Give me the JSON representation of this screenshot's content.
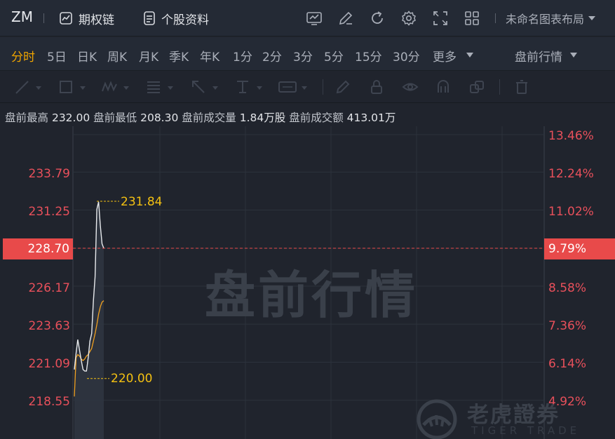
{
  "header": {
    "symbol": "ZM",
    "options_chain": "期权链",
    "stock_profile": "个股资料",
    "layout_name": "未命名图表布局"
  },
  "periods": [
    "分时",
    "5日",
    "日K",
    "周K",
    "月K",
    "季K",
    "年K",
    "1分",
    "2分",
    "3分",
    "5分",
    "15分",
    "30分",
    "更多"
  ],
  "active_period": "分时",
  "market_selector": "盘前行情",
  "info": {
    "high_label": "盘前最高",
    "high": "232.00",
    "low_label": "盘前最低",
    "low": "208.30",
    "volume_label": "盘前成交量",
    "volume": "1.84万股",
    "turnover_label": "盘前成交额",
    "turnover": "413.01万"
  },
  "chart": {
    "watermark": "盘前行情",
    "y_left": [
      "233.79",
      "231.25",
      "228.70",
      "226.17",
      "223.63",
      "221.09",
      "218.55"
    ],
    "y_right": [
      "13.46%",
      "12.24%",
      "11.02%",
      "9.79%",
      "8.58%",
      "7.36%",
      "6.14%",
      "4.92%"
    ],
    "current_price": "228.70",
    "current_pct": "9.79%",
    "high_annotation": "231.84",
    "low_annotation": "220.00"
  },
  "brand": {
    "name": "老虎證券",
    "sub": "TIGER TRADE"
  },
  "colors": {
    "up": "#e8505b",
    "accent": "#f0a500",
    "annotation": "#f3c012",
    "avg_line": "#f0a020"
  },
  "chart_data": {
    "type": "line",
    "title": "",
    "ylim": [
      217.3,
      235.1
    ],
    "y_ticks": [
      218.55,
      221.09,
      223.63,
      226.17,
      228.7,
      231.25,
      233.79
    ],
    "series": [
      {
        "name": "",
        "values": [
          220.6,
          221.7,
          222.6,
          221.9,
          221.2,
          220.6,
          220.5,
          220.5,
          221.4,
          222.5,
          223.0,
          225.2,
          226.8,
          231.3,
          231.8,
          230.2,
          229.0,
          228.7
        ]
      },
      {
        "name": "",
        "values": [
          218.8,
          221.4,
          221.6,
          221.5,
          221.3,
          221.2,
          221.3,
          221.5,
          221.6,
          221.8,
          222.0,
          222.5,
          223.0,
          223.6,
          224.3,
          224.8,
          225.1,
          225.2
        ]
      }
    ],
    "price_line": 228.7,
    "annotations": [
      {
        "label": "231.84",
        "value": 231.84
      },
      {
        "label": "220.00",
        "value": 220.0
      }
    ]
  }
}
